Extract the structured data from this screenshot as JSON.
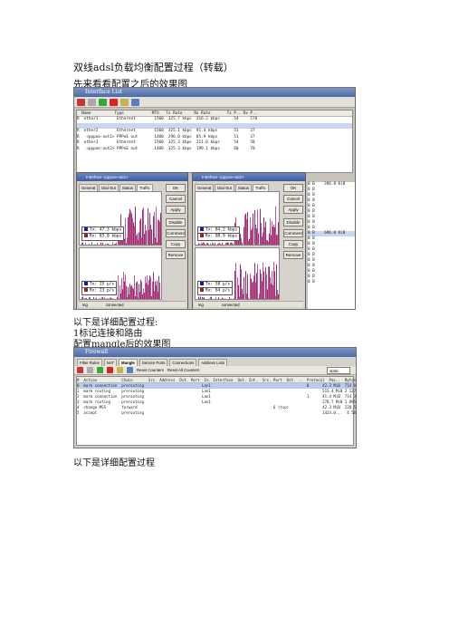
{
  "doc": {
    "title": "双线adsl负载均衡配置过程（转载）",
    "p1": "先来看看配置之后的效果图",
    "p2": "以下是详细配置过程:",
    "p3": "1标记连接和路由",
    "p4": "配置mangle后的效果图",
    "p5": "以下是详细配置过程"
  },
  "shot1": {
    "window_title": "Interface List",
    "list_header": "  Name          Type            MTU   Tx Rate     Rx Rate       Tx P.. Rx P..",
    "rows": [
      "R  ether1        Ethernet        1500  325.7 kbps  316.2 kbps      54     570",
      "",
      "R  ether2        Ethernet        1500  325.1 kbps  91.4 kbps       51     37",
      "R   <pppoe-out1> PPPoE out       1480  296.0 kbps  85.9 kbps       51     37",
      "R  ether3        Ethernet        1500  325.3 kbps  211.6 kbps      54     58",
      "R   <pppoe-out2> PPPoE out       1480  325.3 kbps  199.1 kbps      60     70"
    ],
    "dlg1": {
      "title": "Interface <pppoe-out1>",
      "tabs": [
        "General",
        "Dial Out",
        "Status",
        "Traffic"
      ],
      "buttons": [
        "OK",
        "Cancel",
        "Apply",
        "Disable",
        "Comment",
        "Copy",
        "Remove"
      ],
      "tx_bps": "Tx:  47.3 kbps",
      "rx_bps": "Rx:  83.0 kbps",
      "tx_pps": "Tx:  25 p/s",
      "rx_pps": "Rx:  23 p/s",
      "status_a": "ing",
      "status_b": "connected"
    },
    "dlg2": {
      "title": "Interface <pppoe-out2>",
      "tabs": [
        "General",
        "Dial Out",
        "Status",
        "Traffic"
      ],
      "buttons": [
        "OK",
        "Cancel",
        "Apply",
        "Disable",
        "Comment",
        "Copy",
        "Remove"
      ],
      "tx_bps": "Tx:  84.2 kbps",
      "rx_bps": "Rx:  98.9 kbps",
      "tx_pps": "Tx:  58 p/s",
      "rx_pps": "Rx:  64 p/s",
      "status_a": "ing",
      "status_b": "connected"
    },
    "right_col": [
      "0 B    396.8 KiB",
      "0 B",
      "0 B",
      "0 B",
      "0 B",
      "0 B",
      "0 B",
      "0 B",
      "0 B",
      "0 B    696.0 KiB",
      "0 B",
      "0 B",
      "0 B",
      "0 B",
      "0 B",
      "0 B",
      "0 B",
      "0 B",
      "0 B"
    ]
  },
  "shot2": {
    "window_title": "Firewall",
    "tabs": [
      "Filter Rules",
      "NAT",
      "Mangle",
      "Service Ports",
      "Connections",
      "Address Lists"
    ],
    "active_tab": "Mangle",
    "toolbar": [
      "Reset Counters",
      "Reset All Counters"
    ],
    "select_value": "static",
    "header": "#  Action           Chain       Src. Address  Dst. Port  In. Interface  Out. Int.  Src. Port  Dst. ..  Protocol  Pac..  Bytes    Packets",
    "rows": [
      "0  mark connection  prerouting                          Lan1                                           0      42.3 MiB  714 838",
      "1  mark routing     prerouting                          Lan1                                                  515.4 MiB 2 127 905",
      "2  mark connection  prerouting                          Lan1                                           1      41.4 MiB  714 326",
      "3  mark routing     prerouting                          Lan1                                                  278.7 MiB 1 895 366",
      "4  change MSS       forward                                                             6 (tcp)               42.3 MiB  228 507",
      "5  accept           prerouting                                                                                1424.0...  4 500 119"
    ]
  }
}
